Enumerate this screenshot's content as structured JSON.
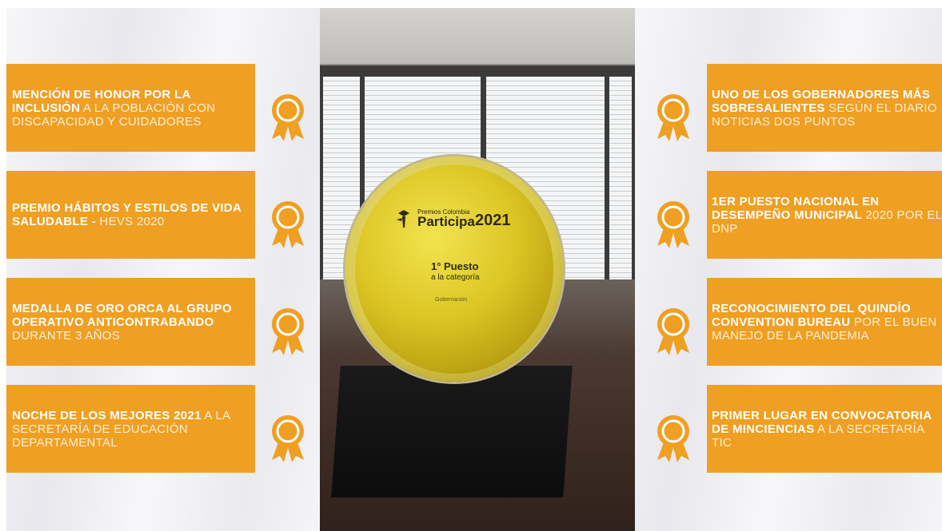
{
  "left_awards": [
    {
      "bold": "MENCIÓN DE HONOR POR LA INCLUSIÓN",
      "light": " A LA POBLACIÓN CON DISCAPACIDAD Y CUIDADORES"
    },
    {
      "bold": "PREMIO HÁBITOS Y ESTILOS DE VIDA SALUDABLE -",
      "light": " HEVS 2020"
    },
    {
      "bold": "MEDALLA DE ORO ORCA AL GRUPO OPERATIVO ANTICONTRABANDO",
      "light": " DURANTE 3 AÑOS"
    },
    {
      "bold": "NOCHE DE LOS MEJORES 2021",
      "light": " A LA SECRETARÍA DE EDUCACIÓN DEPARTAMENTAL"
    }
  ],
  "right_awards": [
    {
      "bold": "UNO DE LOS GOBERNADORES MÁS SOBRESALIENTES",
      "light": " SEGÚN EL DIARIO NOTICIAS DOS PUNTOS"
    },
    {
      "bold": "1ER PUESTO NACIONAL EN DESEMPEÑO MUNICIPAL",
      "light": " 2020 POR EL DNP"
    },
    {
      "bold": "RECONOCIMIENTO DEL QUINDÍO CONVENTION BUREAU",
      "light": " POR EL BUEN MANEJO DE LA PANDEMIA"
    },
    {
      "bold": "PRIMER LUGAR EN CONVOCATORIA DE MINCIENCIAS",
      "light": " A LA SECRETARÍA TIC"
    }
  ],
  "trophy": {
    "small_label": "Premios Colombia",
    "big_label": "Participa",
    "year": "2021",
    "puesto": "1° Puesto",
    "category": "a la categoría",
    "sub": "Gobernación"
  },
  "colors": {
    "accent": "#ef9f22",
    "panel": "#eeeef2",
    "text": "#ffffff"
  },
  "icons": {
    "award": "award-ribbon-icon"
  }
}
